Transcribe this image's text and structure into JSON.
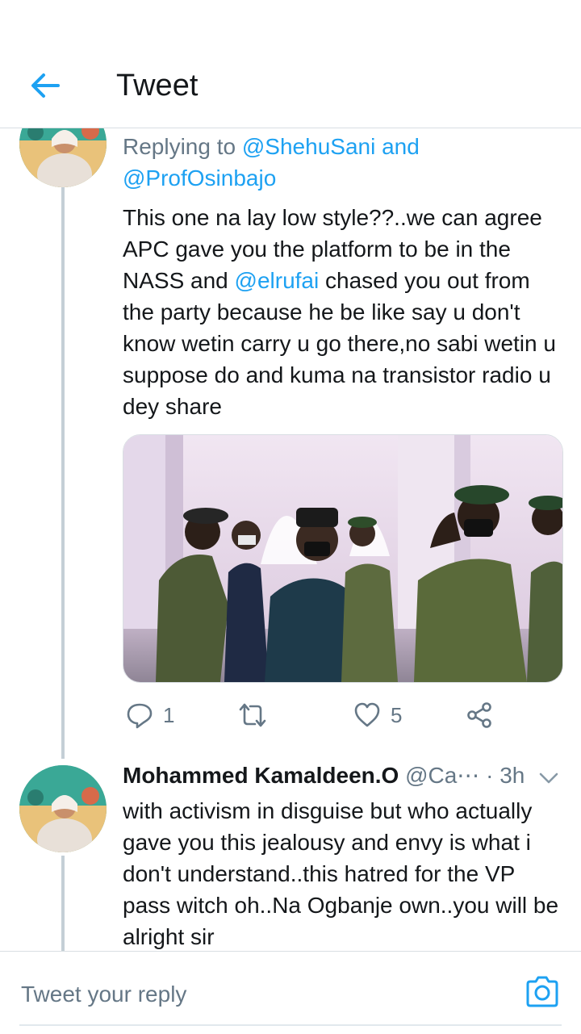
{
  "header": {
    "title": "Tweet"
  },
  "tweet1": {
    "replying_prefix": "Replying to ",
    "mention1": "@ShehuSani",
    "and_word": " and",
    "mention2": "@ProfOsinbajo",
    "body_part1": "This one na lay low style??..we can agree APC gave you the platform to be in the NASS and ",
    "body_mention": "@elrufai",
    "body_part2": " chased you out from the party because he be like say u don't know wetin carry u go there,no sabi wetin u suppose do and kuma na transistor radio u dey share",
    "reply_count": "1",
    "like_count": "5"
  },
  "tweet2": {
    "author_name": "Mohammed Kamaldeen.O",
    "handle": "@Ca⋯",
    "time": " · 3h",
    "body": "with activism in disguise but who actually gave you this jealousy and envy is what i don't understand..this hatred for the VP pass witch oh..Na Ogbanje own..you will be alright sir"
  },
  "reply_bar": {
    "placeholder": "Tweet your reply"
  },
  "colors": {
    "accent": "#1da1f2",
    "muted": "#657786",
    "text": "#14171a"
  },
  "icons": [
    "back-arrow-icon",
    "reply-icon",
    "retweet-icon",
    "like-icon",
    "share-icon",
    "chevron-down-icon",
    "camera-icon"
  ]
}
